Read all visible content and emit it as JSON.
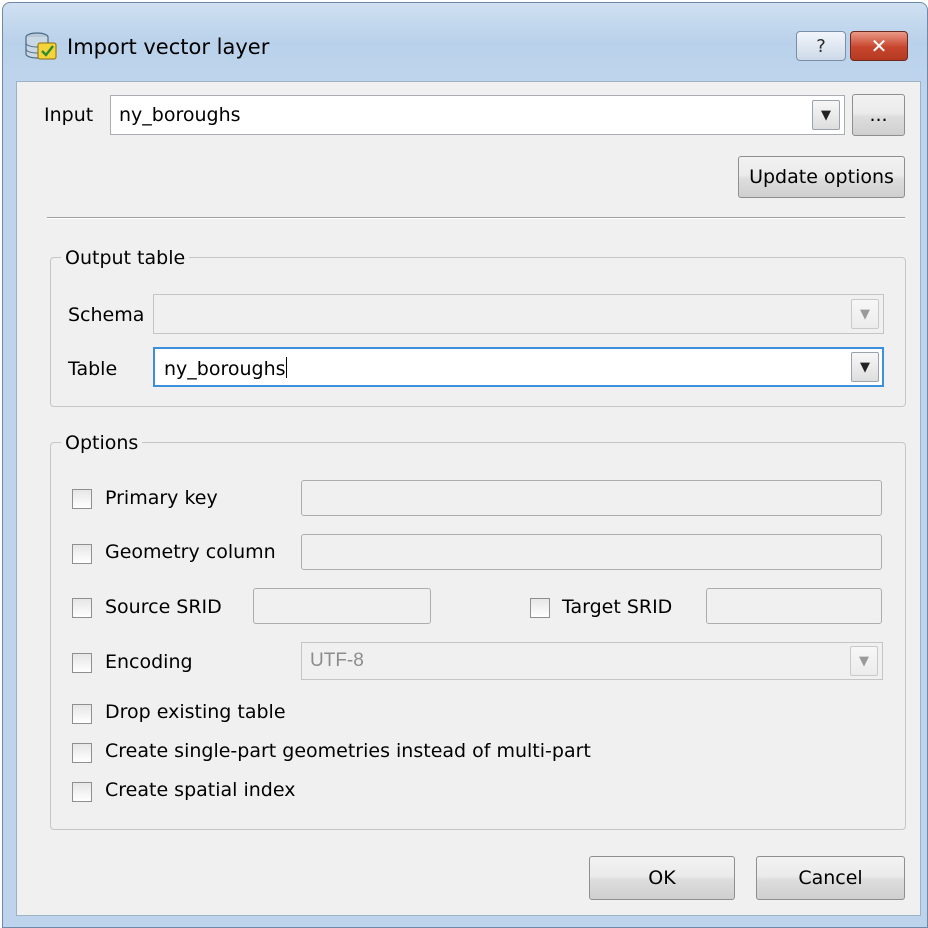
{
  "window": {
    "title": "Import vector layer",
    "help_label": "?",
    "close_label": "✕"
  },
  "input": {
    "label": "Input",
    "value": "ny_boroughs",
    "browse_label": "...",
    "update_options_label": "Update options"
  },
  "output_table": {
    "group_label": "Output table",
    "schema_label": "Schema",
    "schema_value": "",
    "table_label": "Table",
    "table_value": "ny_boroughs"
  },
  "options": {
    "group_label": "Options",
    "primary_key_label": "Primary key",
    "primary_key_value": "",
    "geometry_column_label": "Geometry column",
    "geometry_column_value": "",
    "source_srid_label": "Source SRID",
    "source_srid_value": "",
    "target_srid_label": "Target SRID",
    "target_srid_value": "",
    "encoding_label": "Encoding",
    "encoding_value": "UTF-8",
    "drop_existing_label": "Drop existing table",
    "single_part_label": "Create single-part geometries instead of multi-part",
    "spatial_index_label": "Create spatial index"
  },
  "buttons": {
    "ok_label": "OK",
    "cancel_label": "Cancel"
  },
  "icons": {
    "app": "database-import-icon",
    "dropdown": "chevron-down-icon"
  }
}
